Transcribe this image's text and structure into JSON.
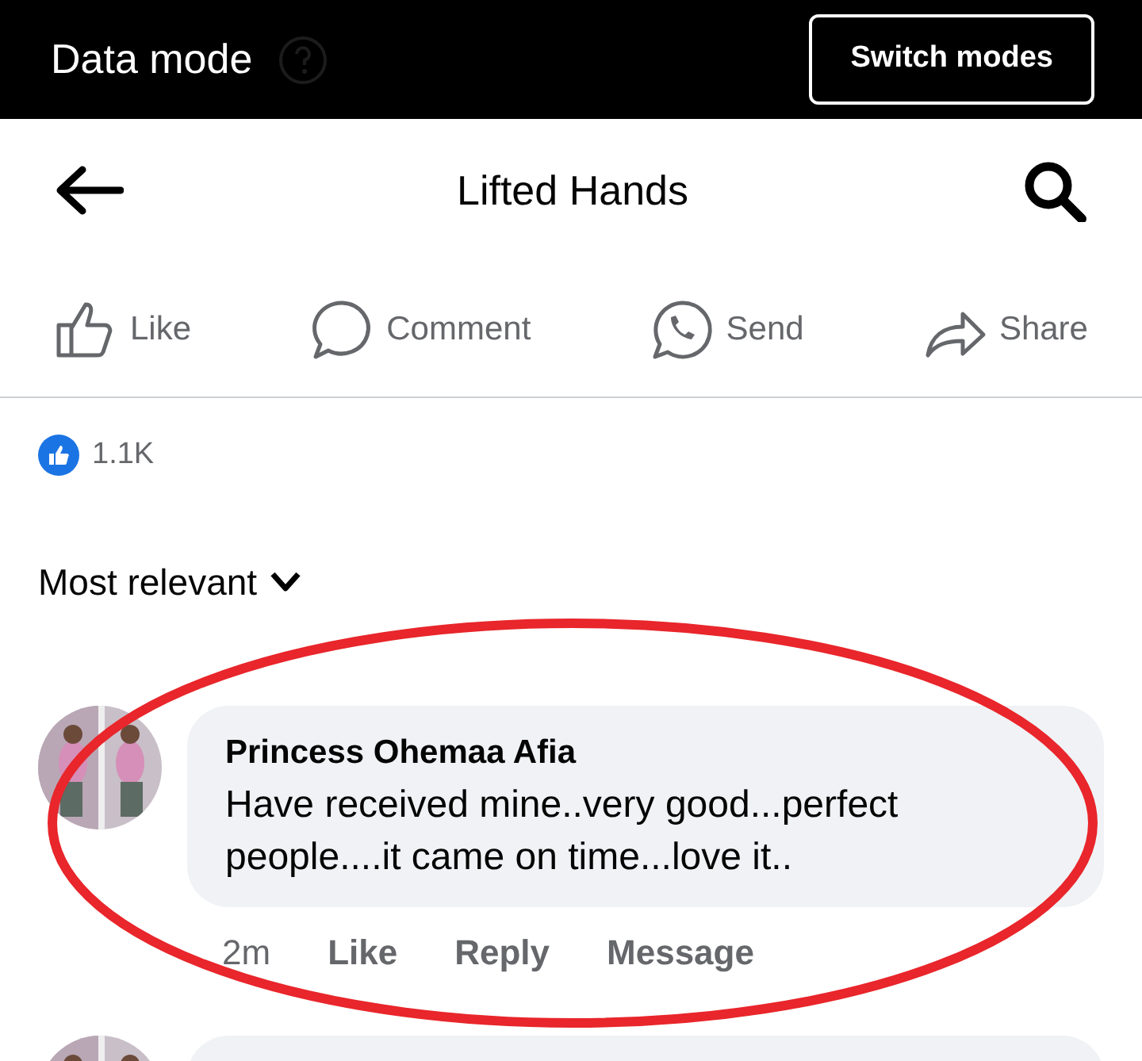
{
  "header": {
    "title": "Data mode",
    "button": "Switch modes"
  },
  "nav": {
    "title": "Lifted Hands"
  },
  "actions": [
    {
      "label": "Like",
      "kind": "like"
    },
    {
      "label": "Comment",
      "kind": "comment"
    },
    {
      "label": "Send",
      "kind": "send"
    },
    {
      "label": "Share",
      "kind": "share"
    }
  ],
  "reactions": {
    "count": "1.1K"
  },
  "sort": {
    "label": "Most relevant"
  },
  "comments": [
    {
      "cut_off": false,
      "author": "Princess Ohemaa Afia",
      "text": "Have received mine..very good...perfect people....it came on time...love it..",
      "time": "2m",
      "links": [
        "Like",
        "Reply",
        "Message"
      ]
    },
    {
      "cut_off": true
    }
  ]
}
